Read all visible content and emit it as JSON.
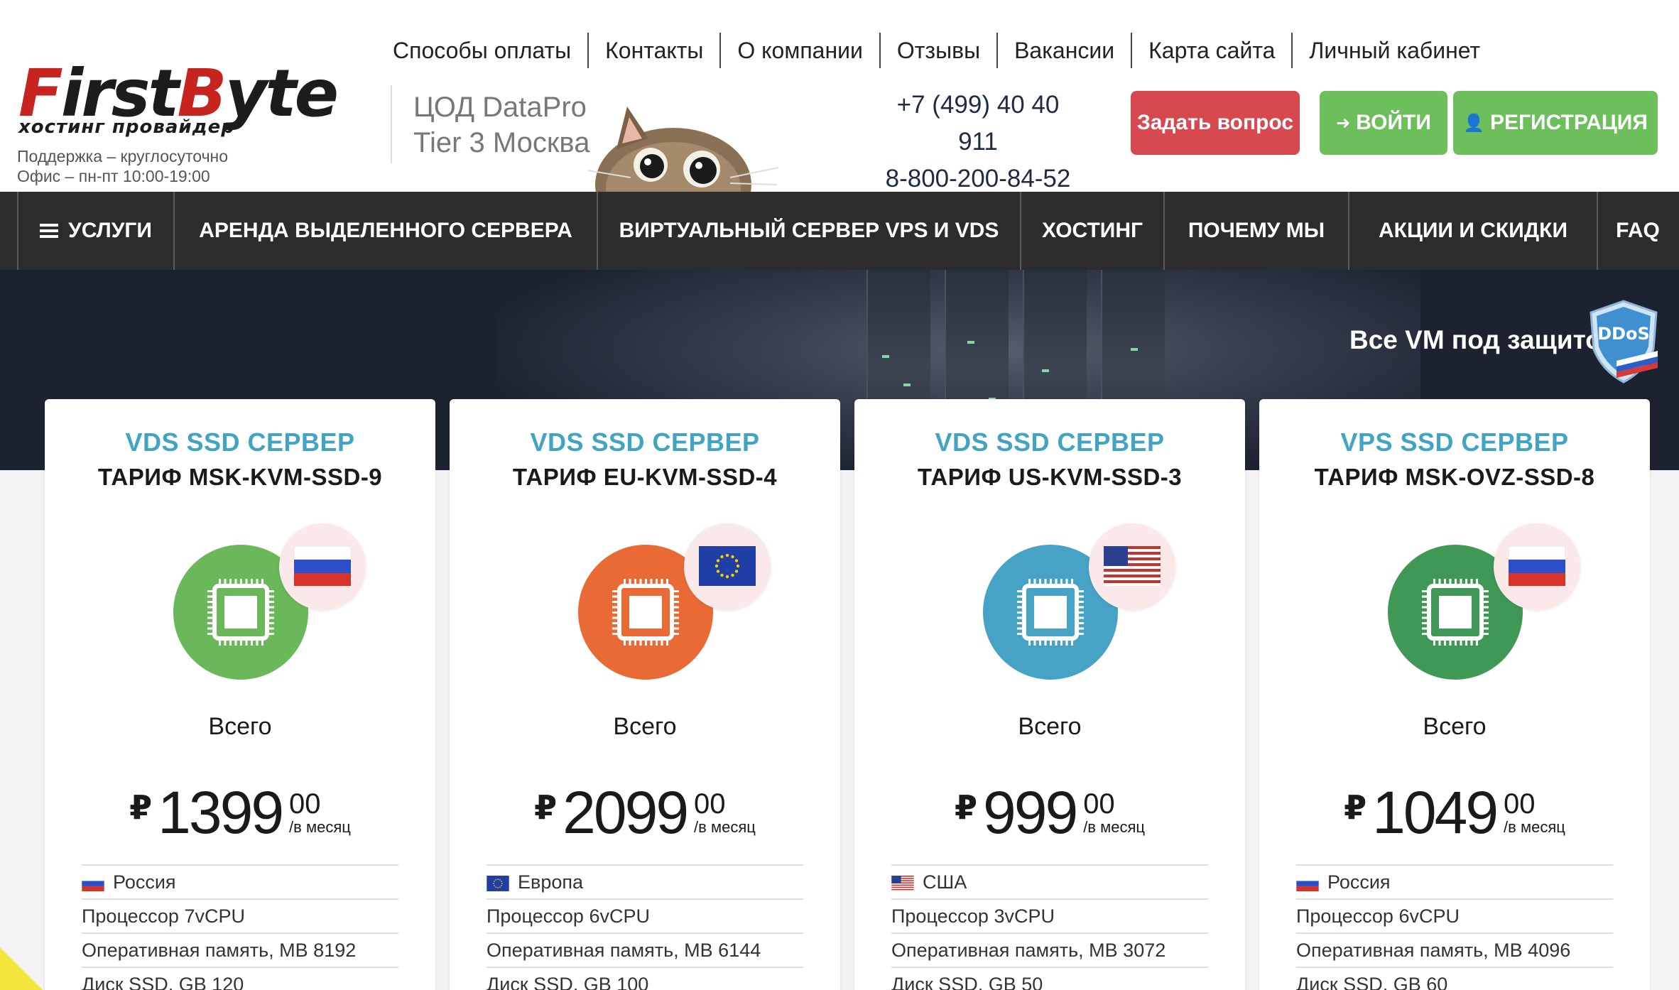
{
  "logo": {
    "word_red": "F",
    "word_mid": "irst",
    "word_red2": "B",
    "word_end": "yte",
    "subtitle": "хостинг провайдер"
  },
  "support": {
    "line1": "Поддержка – круглосуточно",
    "line2": "Офис – пн-пт 10:00-19:00"
  },
  "datacenter": {
    "line1": "ЦОД DataPro",
    "line2": "Tier 3 Москва"
  },
  "top_nav": [
    "Способы оплаты",
    "Контакты",
    "О компании",
    "Отзывы",
    "Вакансии",
    "Карта сайта",
    "Личный кабинет"
  ],
  "phones": {
    "phone1": "+7 (499) 40 40 911",
    "phone2": "8-800-200-84-52"
  },
  "buttons": {
    "ask": "Задать вопрос",
    "login": "ВОЙТИ",
    "register": "РЕГИСТРАЦИЯ"
  },
  "main_nav": [
    "УСЛУГИ",
    "АРЕНДА ВЫДЕЛЕННОГО СЕРВЕРА",
    "ВИРТУАЛЬНЫЙ СЕРВЕР VPS И VDS",
    "ХОСТИНГ",
    "ПОЧЕМУ МЫ",
    "АКЦИИ И СКИДКИ",
    "FAQ"
  ],
  "banner": {
    "text": "Все VM под защитой",
    "badge": "DDoS"
  },
  "cards": [
    {
      "type": "VDS SSD СЕРВЕР",
      "tariff": "ТАРИФ MSK-KVM-SSD-9",
      "chip_color": "#6ab85a",
      "flag": "ru",
      "total": "Всего",
      "currency": "₽",
      "amount": "1399",
      "cents": "00",
      "per": "/в месяц",
      "location": "Россия",
      "cpu": "Процессор 7vCPU",
      "ram": "Оперативная память, MB 8192",
      "disk": "Диск SSD, GB 120"
    },
    {
      "type": "VDS SSD СЕРВЕР",
      "tariff": "ТАРИФ EU-KVM-SSD-4",
      "chip_color": "#ea6a35",
      "flag": "eu",
      "total": "Всего",
      "currency": "₽",
      "amount": "2099",
      "cents": "00",
      "per": "/в месяц",
      "location": "Европа",
      "cpu": "Процессор 6vCPU",
      "ram": "Оперативная память, MB 6144",
      "disk": "Диск SSD, GB 100"
    },
    {
      "type": "VDS SSD СЕРВЕР",
      "tariff": "ТАРИФ US-KVM-SSD-3",
      "chip_color": "#47a3c6",
      "flag": "us",
      "total": "Всего",
      "currency": "₽",
      "amount": "999",
      "cents": "00",
      "per": "/в месяц",
      "location": "США",
      "cpu": "Процессор 3vCPU",
      "ram": "Оперативная память, MB 3072",
      "disk": "Диск SSD, GB 50"
    },
    {
      "type": "VPS SSD СЕРВЕР",
      "tariff": "ТАРИФ MSK-OVZ-SSD-8",
      "chip_color": "#3f9856",
      "flag": "ru",
      "total": "Всего",
      "currency": "₽",
      "amount": "1049",
      "cents": "00",
      "per": "/в месяц",
      "location": "Россия",
      "cpu": "Процессор 6vCPU",
      "ram": "Оперативная память, MB 4096",
      "disk": "Диск SSD, GB 60"
    }
  ],
  "colors": {
    "accent_blue": "#41a4c3",
    "nav_bg": "#2c2c2e",
    "button_red": "#d64a4f",
    "button_green": "#6cbf5b",
    "brand_red": "#c8241f"
  }
}
